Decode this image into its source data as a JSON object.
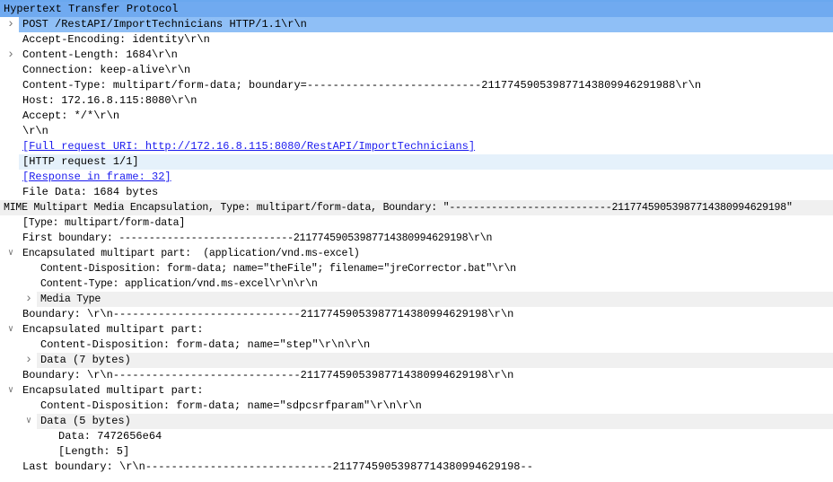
{
  "packet_details": {
    "rows": [
      {
        "text": "Hypertext Transfer Protocol",
        "level": 0,
        "arrow": null,
        "state": "section",
        "narrow": false
      },
      {
        "text": "POST /RestAPI/ImportTechnicians HTTP/1.1\\r\\n",
        "level": 1,
        "arrow": "right",
        "state": "selected",
        "narrow": false
      },
      {
        "text": "Accept-Encoding: identity\\r\\n",
        "level": 1,
        "arrow": null,
        "state": "",
        "narrow": false
      },
      {
        "text": "Content-Length: 1684\\r\\n",
        "level": 1,
        "arrow": "right",
        "state": "",
        "narrow": false
      },
      {
        "text": "Connection: keep-alive\\r\\n",
        "level": 1,
        "arrow": null,
        "state": "",
        "narrow": false
      },
      {
        "text": "Content-Type: multipart/form-data; boundary=---------------------------211774590539877143809946291988\\r\\n",
        "level": 1,
        "arrow": null,
        "state": "",
        "narrow": false
      },
      {
        "text": "Host: 172.16.8.115:8080\\r\\n",
        "level": 1,
        "arrow": null,
        "state": "",
        "narrow": false
      },
      {
        "text": "Accept: */*\\r\\n",
        "level": 1,
        "arrow": null,
        "state": "",
        "narrow": false
      },
      {
        "text": "\\r\\n",
        "level": 1,
        "arrow": null,
        "state": "",
        "narrow": false
      },
      {
        "text": "[Full request URI: http://172.16.8.115:8080/RestAPI/ImportTechnicians]",
        "level": 1,
        "arrow": null,
        "state": "link",
        "narrow": false
      },
      {
        "text": "[HTTP request 1/1]",
        "level": 1,
        "arrow": null,
        "state": "hover",
        "narrow": false
      },
      {
        "text": "[Response in frame: 32]",
        "level": 1,
        "arrow": null,
        "state": "link",
        "narrow": false
      },
      {
        "text": "File Data: 1684 bytes",
        "level": 1,
        "arrow": null,
        "state": "",
        "narrow": false
      },
      {
        "text": "MIME Multipart Media Encapsulation, Type: multipart/form-data, Boundary: \"---------------------------211774590539877143809946291 98\"",
        "level": 0,
        "arrow": null,
        "state": "grey",
        "narrow": true
      },
      {
        "text": "[Type: multipart/form-data]",
        "level": 1,
        "arrow": null,
        "state": "",
        "narrow": true
      },
      {
        "text": "First boundary: -----------------------------211774590539877143809946291 98\\r\\n",
        "level": 1,
        "arrow": null,
        "state": "",
        "narrow": true
      },
      {
        "text": "Encapsulated multipart part:  (application/vnd.ms-excel)",
        "level": 1,
        "arrow": "down",
        "state": "",
        "narrow": true
      },
      {
        "text": "Content-Disposition: form-data; name=\"theFile\"; filename=\"jreCorrector.bat\"\\r\\n",
        "level": 2,
        "arrow": null,
        "state": "",
        "narrow": true
      },
      {
        "text": "Content-Type: application/vnd.ms-excel\\r\\n\\r\\n",
        "level": 2,
        "arrow": null,
        "state": "",
        "narrow": true
      },
      {
        "text": "Media Type",
        "level": 2,
        "arrow": "right",
        "state": "grey",
        "narrow": true
      },
      {
        "text": "Boundary: \\r\\n-----------------------------211774590539877143809946291 98\\r\\n",
        "level": 1,
        "arrow": null,
        "state": "",
        "narrow": false
      },
      {
        "text": "Encapsulated multipart part:",
        "level": 1,
        "arrow": "down",
        "state": "",
        "narrow": false
      },
      {
        "text": "Content-Disposition: form-data; name=\"step\"\\r\\n\\r\\n",
        "level": 2,
        "arrow": null,
        "state": "",
        "narrow": false
      },
      {
        "text": "Data (7 bytes)",
        "level": 2,
        "arrow": "right",
        "state": "grey",
        "narrow": false
      },
      {
        "text": "Boundary: \\r\\n-----------------------------211774590539877143809946291 98\\r\\n",
        "level": 1,
        "arrow": null,
        "state": "",
        "narrow": false
      },
      {
        "text": "Encapsulated multipart part:",
        "level": 1,
        "arrow": "down",
        "state": "",
        "narrow": false
      },
      {
        "text": "Content-Disposition: form-data; name=\"sdpcsrfparam\"\\r\\n\\r\\n",
        "level": 2,
        "arrow": null,
        "state": "",
        "narrow": false
      },
      {
        "text": "Data (5 bytes)",
        "level": 2,
        "arrow": "down",
        "state": "grey",
        "narrow": false
      },
      {
        "text": "Data: 7472656e64",
        "level": 3,
        "arrow": null,
        "state": "",
        "narrow": false
      },
      {
        "text": "[Length: 5]",
        "level": 3,
        "arrow": null,
        "state": "",
        "narrow": false
      },
      {
        "text": "Last boundary: \\r\\n-----------------------------211774590539877143809946291 98--",
        "level": 1,
        "arrow": null,
        "state": "",
        "narrow": false
      }
    ]
  }
}
